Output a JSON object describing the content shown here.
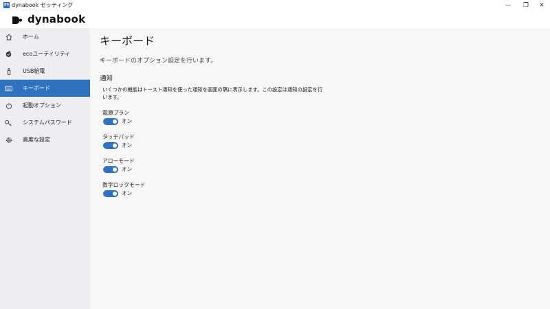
{
  "window": {
    "title": "dynabook セッティング",
    "icon_text": "db",
    "controls": {
      "minimize": "—",
      "maximize": "❐",
      "close": "✕"
    }
  },
  "brand": {
    "logo_text": "dynabook"
  },
  "sidebar": {
    "items": [
      {
        "label": "ホーム",
        "icon": "home-icon",
        "active": false
      },
      {
        "label": "ecoユーティリティ",
        "icon": "eco-icon",
        "active": false
      },
      {
        "label": "USB給電",
        "icon": "usb-icon",
        "active": false
      },
      {
        "label": "キーボード",
        "icon": "keyboard-icon",
        "active": true
      },
      {
        "label": "起動オプション",
        "icon": "power-icon",
        "active": false
      },
      {
        "label": "システムパスワード",
        "icon": "key-icon",
        "active": false
      },
      {
        "label": "高度な設定",
        "icon": "gear-icon",
        "active": false
      }
    ]
  },
  "main": {
    "title": "キーボード",
    "description": "キーボードのオプション設定を行います。",
    "notification": {
      "heading": "通知",
      "description": "いくつかの機能はトースト通知を使った通知を画面の隅に表示します。この設定は通知の設定を行います。",
      "settings": [
        {
          "label": "電源プラン",
          "state": "オン",
          "on": true
        },
        {
          "label": "タッチパッド",
          "state": "オン",
          "on": true
        },
        {
          "label": "アローモード",
          "state": "オン",
          "on": true
        },
        {
          "label": "数字ロックモード",
          "state": "オン",
          "on": true
        }
      ]
    }
  },
  "colors": {
    "accent": "#2e72c0",
    "sidebar_bg": "#eceef2",
    "content_bg": "#f7f7f7"
  }
}
